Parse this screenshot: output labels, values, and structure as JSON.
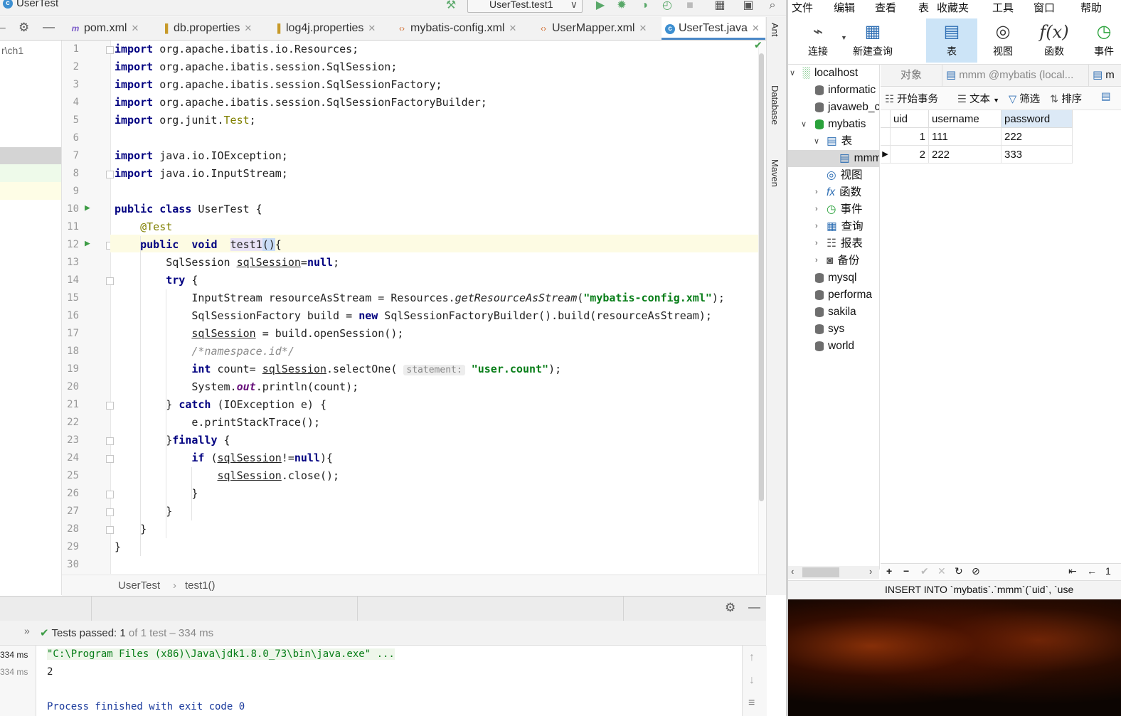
{
  "ide": {
    "title_file": "UserTest",
    "run_config": "UserTest.test1",
    "tabs": [
      {
        "label": "pom.xml",
        "icon": "maven-icon"
      },
      {
        "label": "db.properties",
        "icon": "properties-icon"
      },
      {
        "label": "log4j.properties",
        "icon": "properties-icon"
      },
      {
        "label": "mybatis-config.xml",
        "icon": "xml-icon"
      },
      {
        "label": "UserMapper.xml",
        "icon": "xml-icon"
      },
      {
        "label": "UserTest.java",
        "icon": "java-class-icon"
      }
    ],
    "project_path": "r\\ch1",
    "right_strip": [
      "Ant",
      "Database",
      "Maven"
    ],
    "line_numbers": [
      "1",
      "2",
      "3",
      "4",
      "5",
      "6",
      "7",
      "8",
      "9",
      "10",
      "11",
      "12",
      "13",
      "14",
      "15",
      "16",
      "17",
      "18",
      "19",
      "20",
      "21",
      "22",
      "23",
      "24",
      "25",
      "26",
      "27",
      "28",
      "29",
      "30"
    ],
    "code": {
      "l1": {
        "kw": "import",
        "rest": " org.apache.ibatis.io.Resources;"
      },
      "l2": {
        "kw": "import",
        "rest": " org.apache.ibatis.session.SqlSession;"
      },
      "l3": {
        "kw": "import",
        "rest": " org.apache.ibatis.session.SqlSessionFactory;"
      },
      "l4": {
        "kw": "import",
        "rest": " org.apache.ibatis.session.SqlSessionFactoryBuilder;"
      },
      "l5": {
        "kw": "import",
        "pre": " org.junit.",
        "ann": "Test",
        "post": ";"
      },
      "l7": {
        "kw": "import",
        "rest": " java.io.IOException;"
      },
      "l8": {
        "kw": "import",
        "rest": " java.io.InputStream;"
      },
      "l10": {
        "kw1": "public",
        "kw2": "class",
        "rest": " UserTest {"
      },
      "l11": {
        "ann": "@Test"
      },
      "l12": {
        "kw1": "public",
        "kw2": "void",
        "name": "test1",
        "paren": "()",
        "rest": "{"
      },
      "l13": {
        "pre": "SqlSession ",
        "var": "sqlSession",
        "eq": "=",
        "kw": "null",
        "post": ";"
      },
      "l14": {
        "kw": "try",
        "rest": " {"
      },
      "l15": {
        "pre": "InputStream resourceAsStream = Resources.",
        "method": "getResourceAsStream",
        "open": "(",
        "str": "\"mybatis-config.xml\"",
        "close": ");"
      },
      "l16": {
        "pre": "SqlSessionFactory build = ",
        "kw": "new",
        "rest": " SqlSessionFactoryBuilder().build(resourceAsStream);"
      },
      "l17": {
        "var": "sqlSession",
        "rest": " = build.openSession();"
      },
      "l18": {
        "cmt": "/*namespace.id*/"
      },
      "l19": {
        "kw": "int",
        "pre": " count= ",
        "var": "sqlSession",
        "mid": ".selectOne(",
        "hint": "statement:",
        "str": "\"user.count\"",
        "post": ");"
      },
      "l20": {
        "pre": "System.",
        "fld": "out",
        "post": ".println(count);"
      },
      "l21": {
        "pre": "} ",
        "kw": "catch",
        "rest": " (IOException e) {"
      },
      "l22": {
        "rest": "e.printStackTrace();"
      },
      "l23": {
        "pre": "}",
        "kw": "finally",
        "rest": " {"
      },
      "l24": {
        "kw": "if",
        "pre": " (",
        "var": "sqlSession",
        "mid": "!=",
        "kw2": "null",
        "post": "){"
      },
      "l25": {
        "var": "sqlSession",
        "rest": ".close();"
      },
      "l26": {
        "rest": "}"
      },
      "l27": {
        "rest": "}"
      },
      "l28": {
        "rest": "}"
      },
      "l29": {
        "rest": "}"
      }
    },
    "breadcrumb": [
      "UserTest",
      "test1()"
    ],
    "tests_passed": {
      "label": "Tests passed:",
      "count": "1",
      "detail": "of 1 test – 334 ms"
    },
    "console": {
      "times": [
        "334 ms",
        "334 ms"
      ],
      "cmd": "\"C:\\Program Files (x86)\\Java\\jdk1.8.0_73\\bin\\java.exe\" ...",
      "output": "2",
      "exit": "Process finished with exit code 0"
    }
  },
  "navicat": {
    "menu": [
      "文件",
      "编辑",
      "查看",
      "表",
      "收藏夹",
      "工具",
      "窗口",
      "帮助"
    ],
    "toolbar": [
      {
        "label": "连接",
        "icon": "plug-icon"
      },
      {
        "label": "新建查询",
        "icon": "new-query-icon"
      },
      {
        "label": "表",
        "icon": "table-icon"
      },
      {
        "label": "视图",
        "icon": "view-icon"
      },
      {
        "label": "函数",
        "icon": "function-icon"
      },
      {
        "label": "事件",
        "icon": "clock-icon"
      }
    ],
    "tree": {
      "root": "localhost",
      "dbs_top": [
        "informatic",
        "javaweb_c"
      ],
      "mybatis": "mybatis",
      "table_group": "表",
      "table_item": "mmm",
      "groups": [
        "视图",
        "函数",
        "事件",
        "查询",
        "报表",
        "备份"
      ],
      "dbs_bottom": [
        "mysql",
        "performa",
        "sakila",
        "sys",
        "world"
      ]
    },
    "tabs": [
      "对象",
      "mmm @mybatis (local...",
      "m"
    ],
    "subtoolbar": [
      "开始事务",
      "文本",
      "筛选",
      "排序"
    ],
    "grid": {
      "columns": [
        "uid",
        "username",
        "password"
      ],
      "rows": [
        [
          "1",
          "111",
          "222"
        ],
        [
          "2",
          "222",
          "333"
        ]
      ]
    },
    "status_sql": "INSERT INTO `mybatis`.`mmm`(`uid`, `use",
    "page_number": "1"
  }
}
